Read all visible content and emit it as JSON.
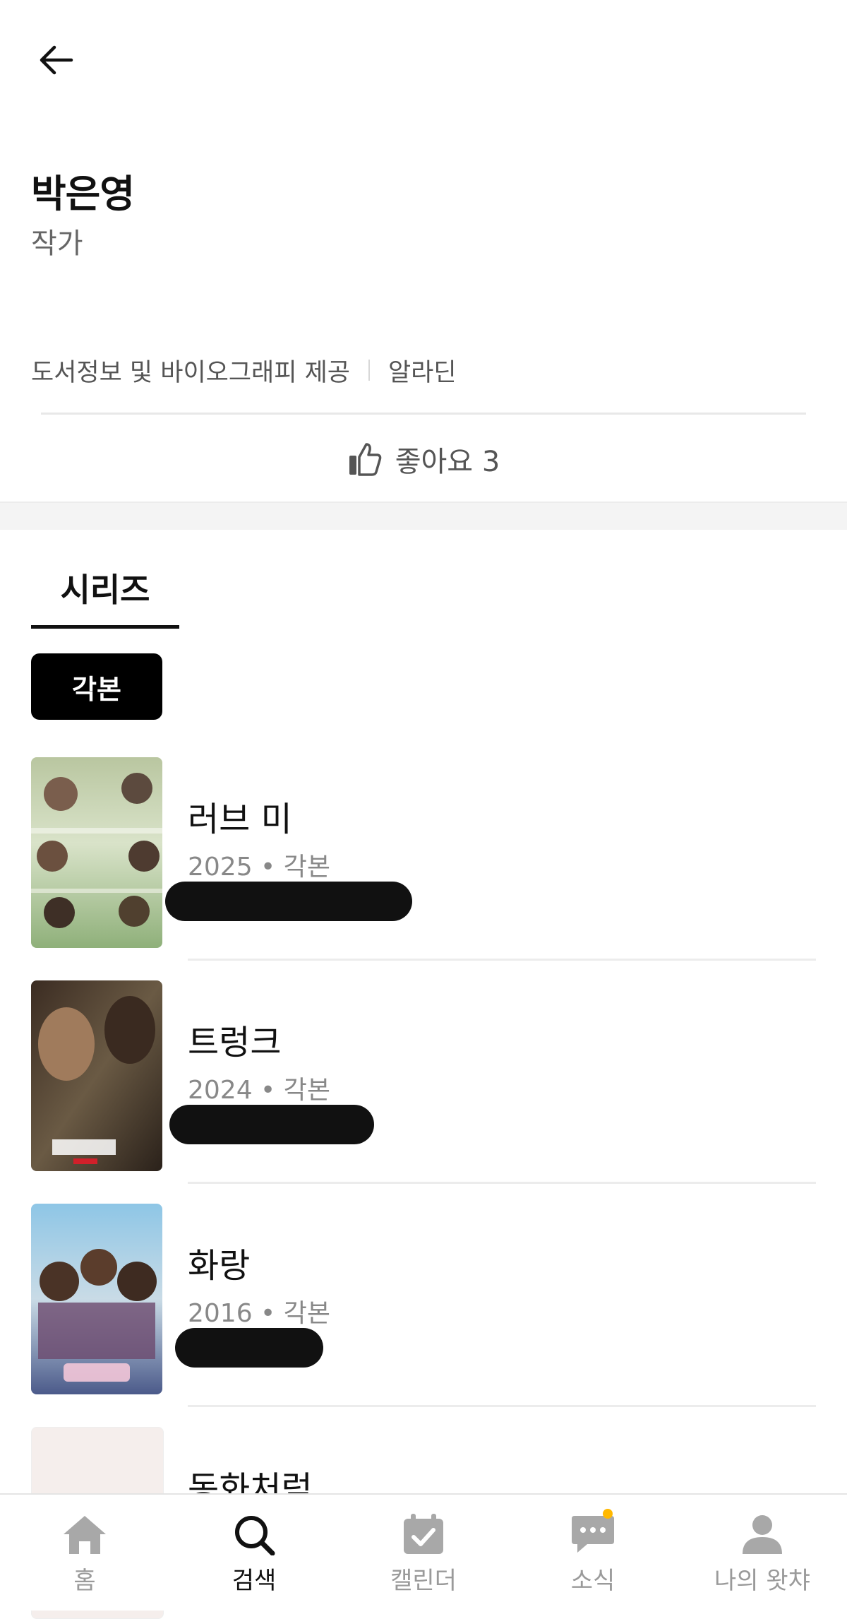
{
  "header": {
    "back_icon": "arrow-left-icon",
    "name": "박은영",
    "role": "작가"
  },
  "credit": {
    "text": "도서정보 및 바이오그래피 제공",
    "provider": "알라딘"
  },
  "like": {
    "label": "좋아요 3",
    "icon": "thumbs-up-icon"
  },
  "tabs": [
    {
      "label": "시리즈",
      "active": true
    }
  ],
  "filter_chip": {
    "label": "각본"
  },
  "series": [
    {
      "title": "러브 미",
      "year": "2025",
      "role": "각본",
      "meta": "2025 • 각본"
    },
    {
      "title": "트렁크",
      "year": "2024",
      "role": "각본",
      "meta": "2024 • 각본"
    },
    {
      "title": "화랑",
      "year": "2016",
      "role": "각본",
      "meta": "2016 • 각본"
    },
    {
      "title": "동화처럼",
      "year": "",
      "role": "",
      "meta": ""
    }
  ],
  "bottom_nav": [
    {
      "label": "홈",
      "icon": "home-icon",
      "active": false
    },
    {
      "label": "검색",
      "icon": "search-icon",
      "active": true
    },
    {
      "label": "캘린더",
      "icon": "calendar-icon",
      "active": false
    },
    {
      "label": "소식",
      "icon": "chat-icon",
      "active": false,
      "badge": true
    },
    {
      "label": "나의 왓챠",
      "icon": "user-icon",
      "active": false
    }
  ],
  "colors": {
    "accent_badge": "#ffb800",
    "text_primary": "#111111",
    "text_secondary": "#888888"
  }
}
